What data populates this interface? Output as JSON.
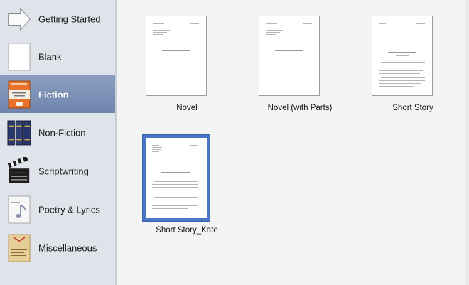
{
  "sidebar": {
    "items": [
      {
        "label": "Getting Started",
        "icon": "arrow-icon"
      },
      {
        "label": "Blank",
        "icon": "blank-page-icon"
      },
      {
        "label": "Fiction",
        "icon": "fiction-book-icon",
        "selected": true
      },
      {
        "label": "Non-Fiction",
        "icon": "books-icon"
      },
      {
        "label": "Scriptwriting",
        "icon": "clapperboard-icon"
      },
      {
        "label": "Poetry & Lyrics",
        "icon": "music-note-page-icon"
      },
      {
        "label": "Miscellaneous",
        "icon": "parchment-icon"
      }
    ]
  },
  "templates": [
    {
      "label": "Novel"
    },
    {
      "label": "Novel (with Parts)"
    },
    {
      "label": "Short Story"
    },
    {
      "label": "Short Story_Kate",
      "selected": true
    }
  ],
  "colors": {
    "selection": "#7588b0",
    "thumb_selected_border": "#4a76c6",
    "sidebar_bg": "#dfe4ea"
  }
}
